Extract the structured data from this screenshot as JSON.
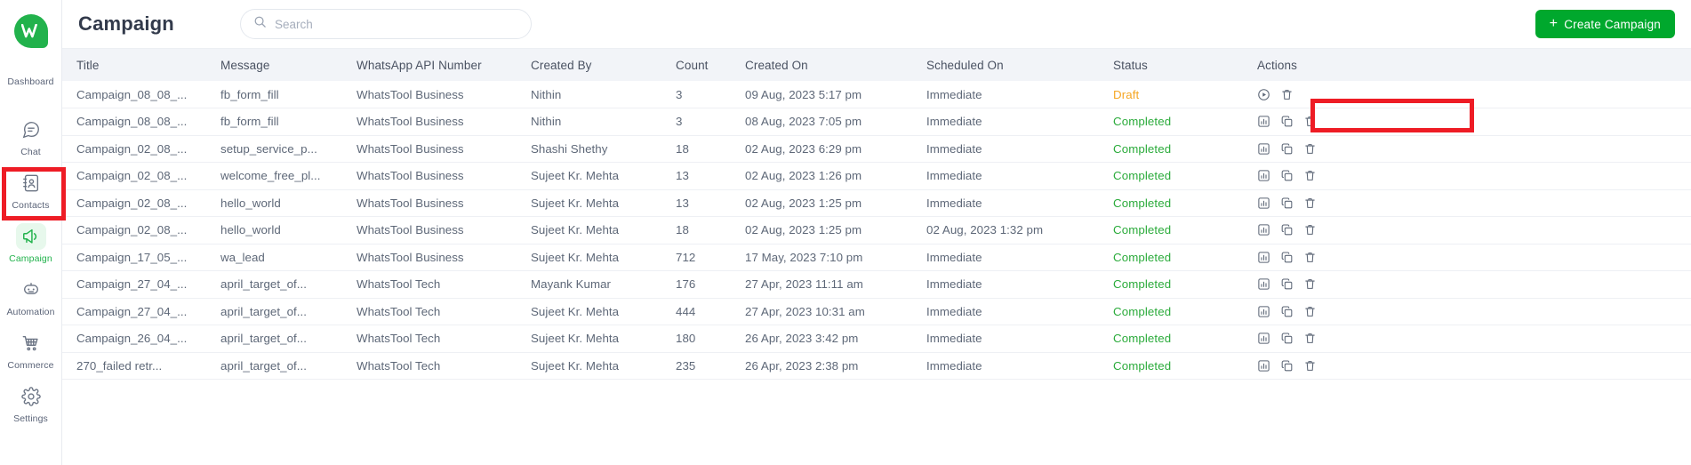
{
  "sidebar": {
    "logo_name": "whatstool-logo",
    "items": [
      {
        "label": "Dashboard",
        "icon": "logo-icon",
        "active": false
      },
      {
        "label": "Chat",
        "icon": "chat-icon",
        "active": false
      },
      {
        "label": "Contacts",
        "icon": "contacts-icon",
        "active": false
      },
      {
        "label": "Campaign",
        "icon": "megaphone-icon",
        "active": true
      },
      {
        "label": "Automation",
        "icon": "robot-icon",
        "active": false
      },
      {
        "label": "Commerce",
        "icon": "cart-icon",
        "active": false
      },
      {
        "label": "Settings",
        "icon": "gear-icon",
        "active": false
      }
    ]
  },
  "header": {
    "title": "Campaign",
    "search_placeholder": "Search",
    "search_value": "",
    "search_icon": "search-icon",
    "create_button": "Create Campaign",
    "create_button_icon": "plus-icon"
  },
  "table": {
    "columns": [
      "Title",
      "Message",
      "WhatsApp API Number",
      "Created By",
      "Count",
      "Created On",
      "Scheduled On",
      "Status",
      "Actions"
    ],
    "rows": [
      {
        "title": "Campaign_08_08_...",
        "message": "fb_form_fill",
        "api_number": "WhatsTool Business",
        "created_by": "Nithin",
        "count": "3",
        "created_on": "09 Aug, 2023 5:17 pm",
        "scheduled_on": "Immediate",
        "status": "Draft",
        "status_kind": "draft",
        "actions": [
          "play-circle-icon",
          "trash-icon"
        ]
      },
      {
        "title": "Campaign_08_08_...",
        "message": "fb_form_fill",
        "api_number": "WhatsTool Business",
        "created_by": "Nithin",
        "count": "3",
        "created_on": "08 Aug, 2023 7:05 pm",
        "scheduled_on": "Immediate",
        "status": "Completed",
        "status_kind": "completed",
        "actions": [
          "analytics-icon",
          "copy-icon",
          "trash-icon"
        ]
      },
      {
        "title": "Campaign_02_08_...",
        "message": "setup_service_p...",
        "api_number": "WhatsTool Business",
        "created_by": "Shashi Shethy",
        "count": "18",
        "created_on": "02 Aug, 2023 6:29 pm",
        "scheduled_on": "Immediate",
        "status": "Completed",
        "status_kind": "completed",
        "actions": [
          "analytics-icon",
          "copy-icon",
          "trash-icon"
        ]
      },
      {
        "title": "Campaign_02_08_...",
        "message": "welcome_free_pl...",
        "api_number": "WhatsTool Business",
        "created_by": "Sujeet Kr. Mehta",
        "count": "13",
        "created_on": "02 Aug, 2023 1:26 pm",
        "scheduled_on": "Immediate",
        "status": "Completed",
        "status_kind": "completed",
        "actions": [
          "analytics-icon",
          "copy-icon",
          "trash-icon"
        ]
      },
      {
        "title": "Campaign_02_08_...",
        "message": "hello_world",
        "api_number": "WhatsTool Business",
        "created_by": "Sujeet Kr. Mehta",
        "count": "13",
        "created_on": "02 Aug, 2023 1:25 pm",
        "scheduled_on": "Immediate",
        "status": "Completed",
        "status_kind": "completed",
        "actions": [
          "analytics-icon",
          "copy-icon",
          "trash-icon"
        ]
      },
      {
        "title": "Campaign_02_08_...",
        "message": "hello_world",
        "api_number": "WhatsTool Business",
        "created_by": "Sujeet Kr. Mehta",
        "count": "18",
        "created_on": "02 Aug, 2023 1:25 pm",
        "scheduled_on": "02 Aug, 2023 1:32 pm",
        "status": "Completed",
        "status_kind": "completed",
        "actions": [
          "analytics-icon",
          "copy-icon",
          "trash-icon"
        ]
      },
      {
        "title": "Campaign_17_05_...",
        "message": "wa_lead",
        "api_number": "WhatsTool Business",
        "created_by": "Sujeet Kr. Mehta",
        "count": "712",
        "created_on": "17 May, 2023 7:10 pm",
        "scheduled_on": "Immediate",
        "status": "Completed",
        "status_kind": "completed",
        "actions": [
          "analytics-icon",
          "copy-icon",
          "trash-icon"
        ]
      },
      {
        "title": "Campaign_27_04_...",
        "message": "april_target_of...",
        "api_number": "WhatsTool Tech",
        "created_by": "Mayank Kumar",
        "count": "176",
        "created_on": "27 Apr, 2023 11:11 am",
        "scheduled_on": "Immediate",
        "status": "Completed",
        "status_kind": "completed",
        "actions": [
          "analytics-icon",
          "copy-icon",
          "trash-icon"
        ]
      },
      {
        "title": "Campaign_27_04_...",
        "message": "april_target_of...",
        "api_number": "WhatsTool Tech",
        "created_by": "Sujeet Kr. Mehta",
        "count": "444",
        "created_on": "27 Apr, 2023 10:31 am",
        "scheduled_on": "Immediate",
        "status": "Completed",
        "status_kind": "completed",
        "actions": [
          "analytics-icon",
          "copy-icon",
          "trash-icon"
        ]
      },
      {
        "title": "Campaign_26_04_...",
        "message": "april_target_of...",
        "api_number": "WhatsTool Tech",
        "created_by": "Sujeet Kr. Mehta",
        "count": "180",
        "created_on": "26 Apr, 2023 3:42 pm",
        "scheduled_on": "Immediate",
        "status": "Completed",
        "status_kind": "completed",
        "actions": [
          "analytics-icon",
          "copy-icon",
          "trash-icon"
        ]
      },
      {
        "title": "270_failed retr...",
        "message": "april_target_of...",
        "api_number": "WhatsTool Tech",
        "created_by": "Sujeet Kr. Mehta",
        "count": "235",
        "created_on": "26 Apr, 2023 2:38 pm",
        "scheduled_on": "Immediate",
        "status": "Completed",
        "status_kind": "completed",
        "actions": [
          "analytics-icon",
          "copy-icon",
          "trash-icon"
        ]
      }
    ]
  },
  "annotations": [
    {
      "name": "sidebar-campaign-highlight",
      "color": "#ee1c25"
    },
    {
      "name": "status-draft-highlight",
      "color": "#ee1c25"
    }
  ],
  "colors": {
    "brand_green": "#22b24c",
    "button_green": "#00a82d",
    "status_completed": "#2bab3b",
    "status_draft": "#f5a623",
    "annotation_red": "#ee1c25",
    "header_bg": "#f2f4f8"
  }
}
